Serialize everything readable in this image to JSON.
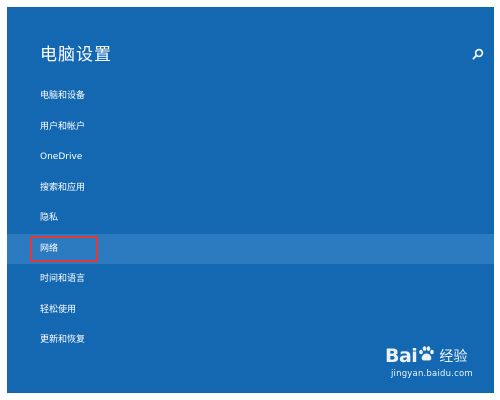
{
  "window": {
    "title": "电脑设置",
    "search_icon": "search-icon"
  },
  "menu": {
    "items": [
      {
        "label": "电脑和设备"
      },
      {
        "label": "用户和帐户"
      },
      {
        "label": "OneDrive"
      },
      {
        "label": "搜索和应用"
      },
      {
        "label": "隐私"
      },
      {
        "label": "网络",
        "selected": true
      },
      {
        "label": "时间和语言"
      },
      {
        "label": "轻松使用"
      },
      {
        "label": "更新和恢复"
      }
    ]
  },
  "watermark": {
    "brand": "Bai",
    "brand_suffix": "经验",
    "url": "jingyan.baidu.com"
  },
  "colors": {
    "background": "#1468b2",
    "selected_row": "#2c7bc0",
    "highlight_box": "#e53935",
    "text": "#ffffff"
  }
}
